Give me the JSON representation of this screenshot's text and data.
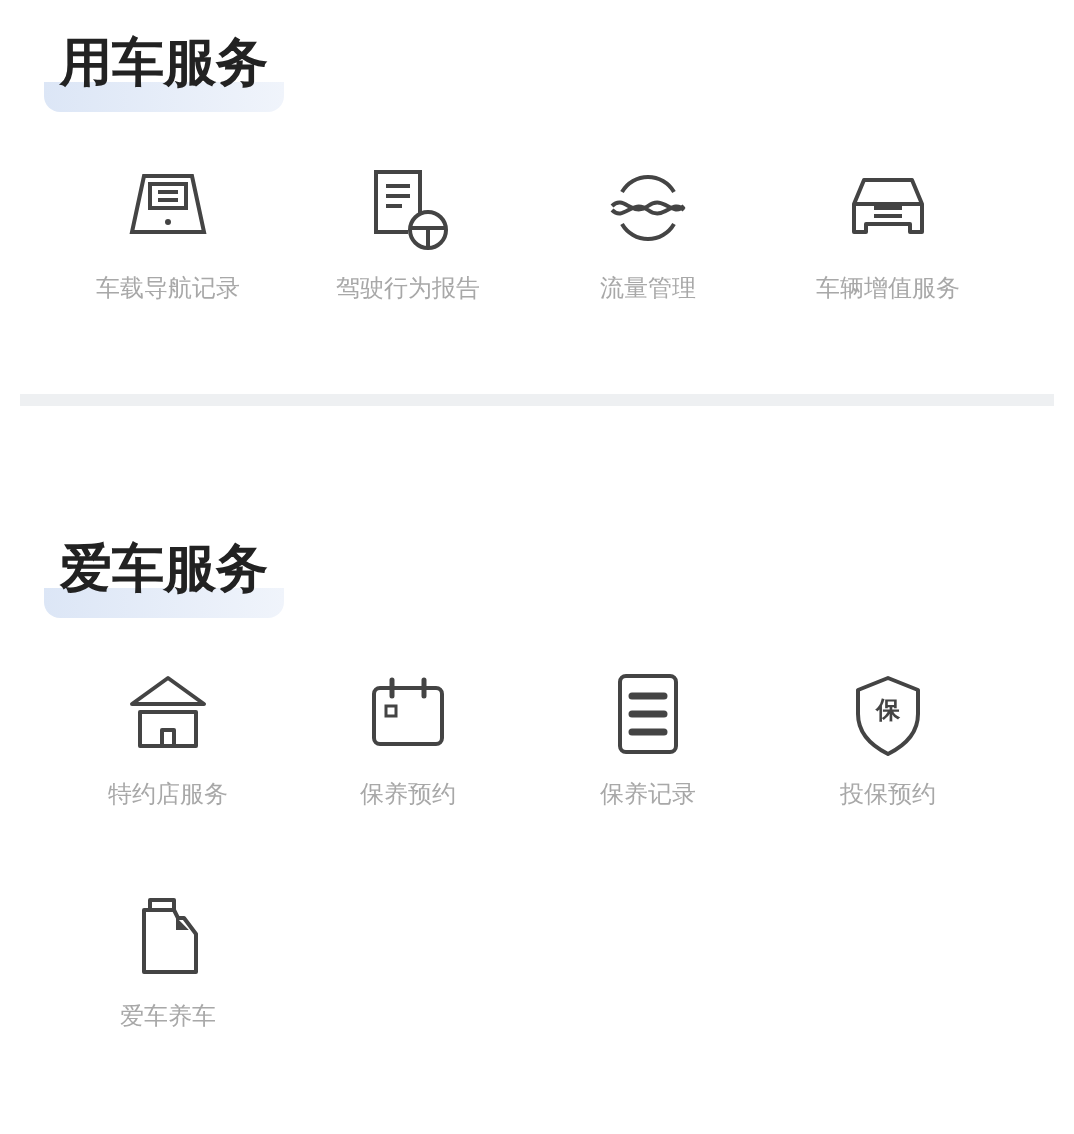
{
  "sections": [
    {
      "title": "用车服务",
      "items": [
        {
          "label": "车载导航记录",
          "kind": "screen"
        },
        {
          "label": "驾驶行为报告",
          "kind": "report"
        },
        {
          "label": "流量管理",
          "kind": "traffic"
        },
        {
          "label": "车辆增值服务",
          "kind": "car"
        }
      ]
    },
    {
      "title": "爱车服务",
      "items": [
        {
          "label": "特约店服务",
          "kind": "store"
        },
        {
          "label": "保养预约",
          "kind": "calendar"
        },
        {
          "label": "保养记录",
          "kind": "list"
        },
        {
          "label": "投保预约",
          "kind": "shield",
          "glyph": "保"
        },
        {
          "label": "爱车养车",
          "kind": "oil"
        }
      ]
    }
  ]
}
